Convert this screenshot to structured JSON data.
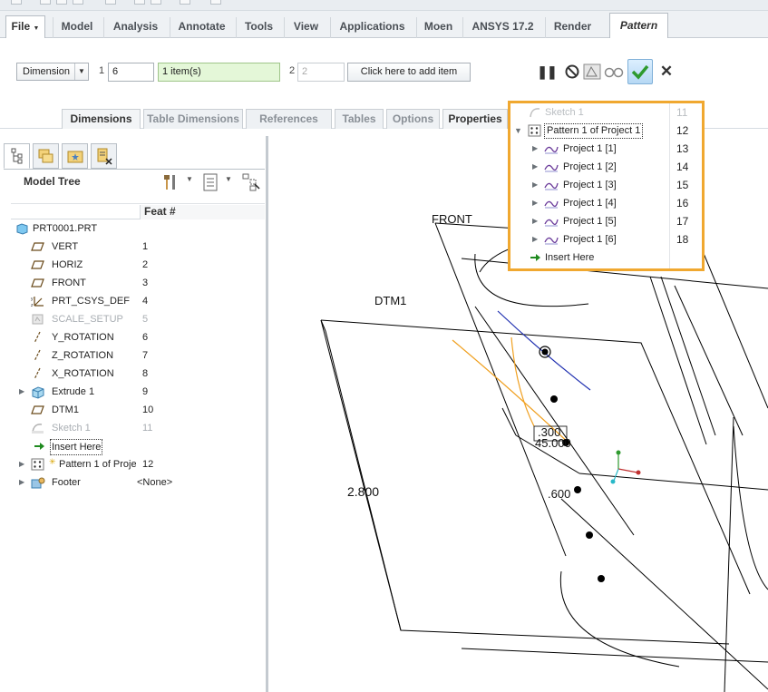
{
  "ribbon": {
    "tabs": [
      {
        "label": "File",
        "id": "file"
      },
      {
        "label": "Model",
        "id": "model"
      },
      {
        "label": "Analysis",
        "id": "analysis"
      },
      {
        "label": "Annotate",
        "id": "annotate"
      },
      {
        "label": "Tools",
        "id": "tools"
      },
      {
        "label": "View",
        "id": "view"
      },
      {
        "label": "Applications",
        "id": "applications"
      },
      {
        "label": "Moen",
        "id": "moen"
      },
      {
        "label": "ANSYS 17.2",
        "id": "ansys"
      },
      {
        "label": "Render",
        "id": "render"
      },
      {
        "label": "Pattern",
        "id": "pattern"
      }
    ],
    "active_tab": "Pattern"
  },
  "dashboard": {
    "pattern_type": "Dimension",
    "dir1_label": "1",
    "dir1_count": "6",
    "dir1_items": "1 item(s)",
    "dir2_label": "2",
    "dir2_count": "2",
    "add_item_button": "Click here to add item",
    "subtabs": [
      "Dimensions",
      "Table Dimensions",
      "References",
      "Tables",
      "Options",
      "Properties"
    ]
  },
  "model_tree": {
    "title": "Model Tree",
    "column_header": "Feat #",
    "rows": [
      {
        "name": "PRT0001.PRT",
        "feat": "",
        "icon": "part-icon"
      },
      {
        "name": "VERT",
        "feat": "1",
        "icon": "datum-plane-icon"
      },
      {
        "name": "HORIZ",
        "feat": "2",
        "icon": "datum-plane-icon"
      },
      {
        "name": "FRONT",
        "feat": "3",
        "icon": "datum-plane-icon"
      },
      {
        "name": "PRT_CSYS_DEF",
        "feat": "4",
        "icon": "csys-icon"
      },
      {
        "name": "SCALE_SETUP",
        "feat": "5",
        "icon": "setup-icon"
      },
      {
        "name": "Y_ROTATION",
        "feat": "6",
        "icon": "datum-axis-icon"
      },
      {
        "name": "Z_ROTATION",
        "feat": "7",
        "icon": "datum-axis-icon"
      },
      {
        "name": "X_ROTATION",
        "feat": "8",
        "icon": "datum-axis-icon"
      },
      {
        "name": "Extrude 1",
        "feat": "9",
        "icon": "extrude-icon"
      },
      {
        "name": "DTM1",
        "feat": "10",
        "icon": "datum-plane-icon"
      },
      {
        "name": "Sketch 1",
        "feat": "11",
        "icon": "sketch-icon"
      },
      {
        "name": "Insert Here",
        "feat": "",
        "icon": "insert-arrow-icon"
      },
      {
        "name": "Pattern 1 of Project 1",
        "feat": "12",
        "icon": "pattern-icon"
      },
      {
        "name": "Footer",
        "feat": "<None>",
        "icon": "footer-icon"
      }
    ]
  },
  "popup": {
    "rows": [
      {
        "name": "Sketch 1",
        "feat": "11"
      },
      {
        "name": "Pattern 1 of Project 1",
        "feat": "12"
      },
      {
        "name": "Project 1 [1]",
        "feat": "13"
      },
      {
        "name": "Project 1 [2]",
        "feat": "14"
      },
      {
        "name": "Project 1 [3]",
        "feat": "15"
      },
      {
        "name": "Project 1 [4]",
        "feat": "16"
      },
      {
        "name": "Project 1 [5]",
        "feat": "17"
      },
      {
        "name": "Project 1 [6]",
        "feat": "18"
      },
      {
        "name": "Insert Here",
        "feat": ""
      }
    ]
  },
  "graphics": {
    "label_front": "FRONT",
    "label_dtm1": "DTM1",
    "dim_height": "2.800",
    "dim_small": ".300",
    "dim_angle": "45.000",
    "dim_offset": ".600"
  },
  "colors": {
    "accent": "#f0a830",
    "ok_green": "#2e9a2e",
    "curve_orange": "#f0a020",
    "curve_blue": "#1f2fb0"
  }
}
